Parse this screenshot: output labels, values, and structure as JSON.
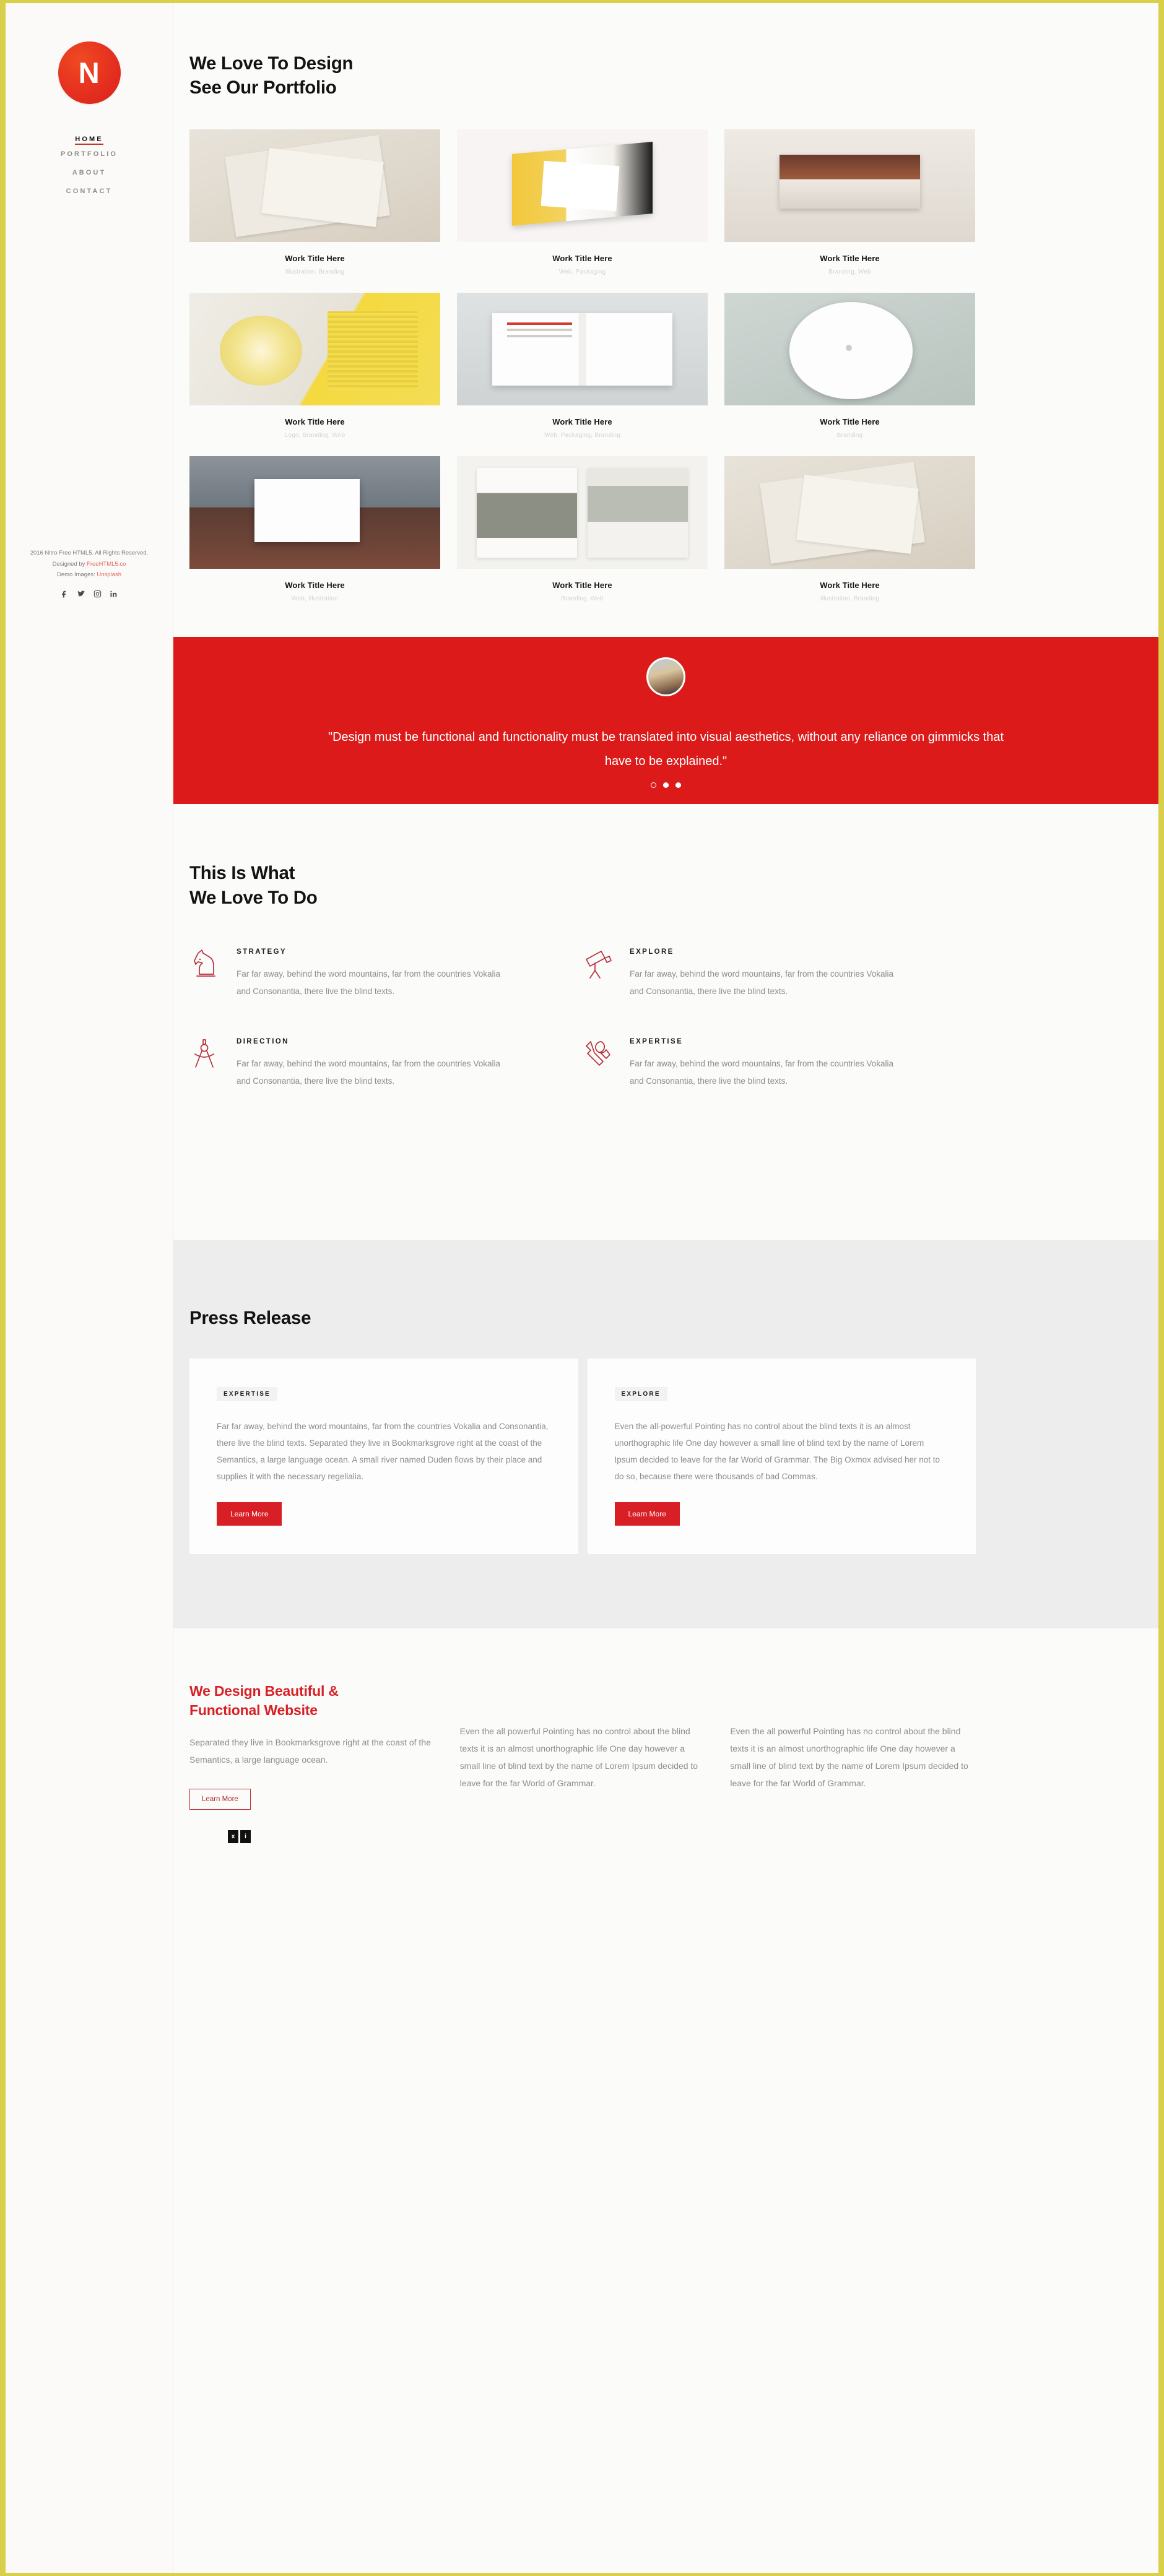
{
  "sidebar": {
    "logo_letter": "N",
    "nav": [
      {
        "label": "HOME",
        "active": true
      },
      {
        "label": "PORTFOLIO",
        "active": false
      },
      {
        "label": "ABOUT",
        "active": false
      },
      {
        "label": "CONTACT",
        "active": false
      }
    ],
    "footer": {
      "copyright": "2016 Nitro Free HTML5. All Rights Reserved.",
      "designed_prefix": "Designed by ",
      "designed_link": "FreeHTML5.co",
      "demo_prefix": "Demo Images: ",
      "demo_link": "Unsplash",
      "socials": [
        "facebook-icon",
        "twitter-icon",
        "instagram-icon",
        "linkedin-icon"
      ]
    }
  },
  "portfolio": {
    "heading_line1": "We Love To Design",
    "heading_line2": "See Our Portfolio",
    "items": [
      {
        "title": "Work Title Here",
        "category": "Illustration, Branding",
        "thumb": "t-papers"
      },
      {
        "title": "Work Title Here",
        "category": "Web, Packaging",
        "thumb": "t-book"
      },
      {
        "title": "Work Title Here",
        "category": "Branding, Web",
        "thumb": "t-mag"
      },
      {
        "title": "Work Title Here",
        "category": "Logo, Branding, Web",
        "thumb": "t-cd"
      },
      {
        "title": "Work Title Here",
        "category": "Web, Packaging, Branding",
        "thumb": "t-fold"
      },
      {
        "title": "Work Title Here",
        "category": "Branding",
        "thumb": "t-vinyl"
      },
      {
        "title": "Work Title Here",
        "category": "Web, Illustration",
        "thumb": "t-poster"
      },
      {
        "title": "Work Title Here",
        "category": "Branding, Web",
        "thumb": "t-photo"
      },
      {
        "title": "Work Title Here",
        "category": "Illustration, Branding",
        "thumb": "t-papers"
      }
    ]
  },
  "testimonial": {
    "avatar": "person-avatar",
    "quote": "\"Design must be functional and functionality must be translated into visual aesthetics, without any reliance on gimmicks that have to be explained.\"",
    "background_color": "#dc1a1a",
    "slides": 3,
    "active_slide": 0
  },
  "services": {
    "heading_line1": "This Is What",
    "heading_line2": "We Love To Do",
    "items": [
      {
        "icon": "chess-knight-icon",
        "title": "STRATEGY",
        "text": "Far far away, behind the word mountains, far from the countries Vokalia and Consonantia, there live the blind texts."
      },
      {
        "icon": "telescope-icon",
        "title": "EXPLORE",
        "text": "Far far away, behind the word mountains, far from the countries Vokalia and Consonantia, there live the blind texts."
      },
      {
        "icon": "compass-icon",
        "title": "DIRECTION",
        "text": "Far far away, behind the word mountains, far from the countries Vokalia and Consonantia, there live the blind texts."
      },
      {
        "icon": "tools-icon",
        "title": "EXPERTISE",
        "text": "Far far away, behind the word mountains, far from the countries Vokalia and Consonantia, there live the blind texts."
      }
    ]
  },
  "press": {
    "heading": "Press Release",
    "cards": [
      {
        "tag": "EXPERTISE",
        "text": "Far far away, behind the word mountains, far from the countries Vokalia and Consonantia, there live the blind texts. Separated they live in Bookmarksgrove right at the coast of the Semantics, a large language ocean. A small river named Duden flows by their place and supplies it with the necessary regelialia.",
        "button": "Learn More"
      },
      {
        "tag": "EXPLORE",
        "text": "Even the all-powerful Pointing has no control about the blind texts it is an almost unorthographic life One day however a small line of blind text by the name of Lorem Ipsum decided to leave for the far World of Grammar. The Big Oxmox advised her not to do so, because there were thousands of bad Commas.",
        "button": "Learn More"
      }
    ]
  },
  "about": {
    "title_line1": "We Design Beautiful &",
    "title_line2": "Functional Website",
    "lead": "Separated they live in Bookmarksgrove right at the coast of the Semantics, a large language ocean.",
    "button": "Learn More",
    "columns": [
      "Even the all powerful Pointing has no control about the blind texts it is an almost unorthographic life One day however a small line of blind text by the name of Lorem Ipsum decided to leave for the far World of Grammar.",
      "Even the all powerful Pointing has no control about the blind texts it is an almost unorthographic life One day however a small line of blind text by the name of Lorem Ipsum decided to leave for the far World of Grammar."
    ],
    "badges": [
      "x",
      "i"
    ]
  },
  "theme": {
    "accent_red": "#d81f26",
    "testimonial_red": "#dc1a1a",
    "border_gold": "#d9cf4a",
    "press_bg": "#ededed"
  }
}
